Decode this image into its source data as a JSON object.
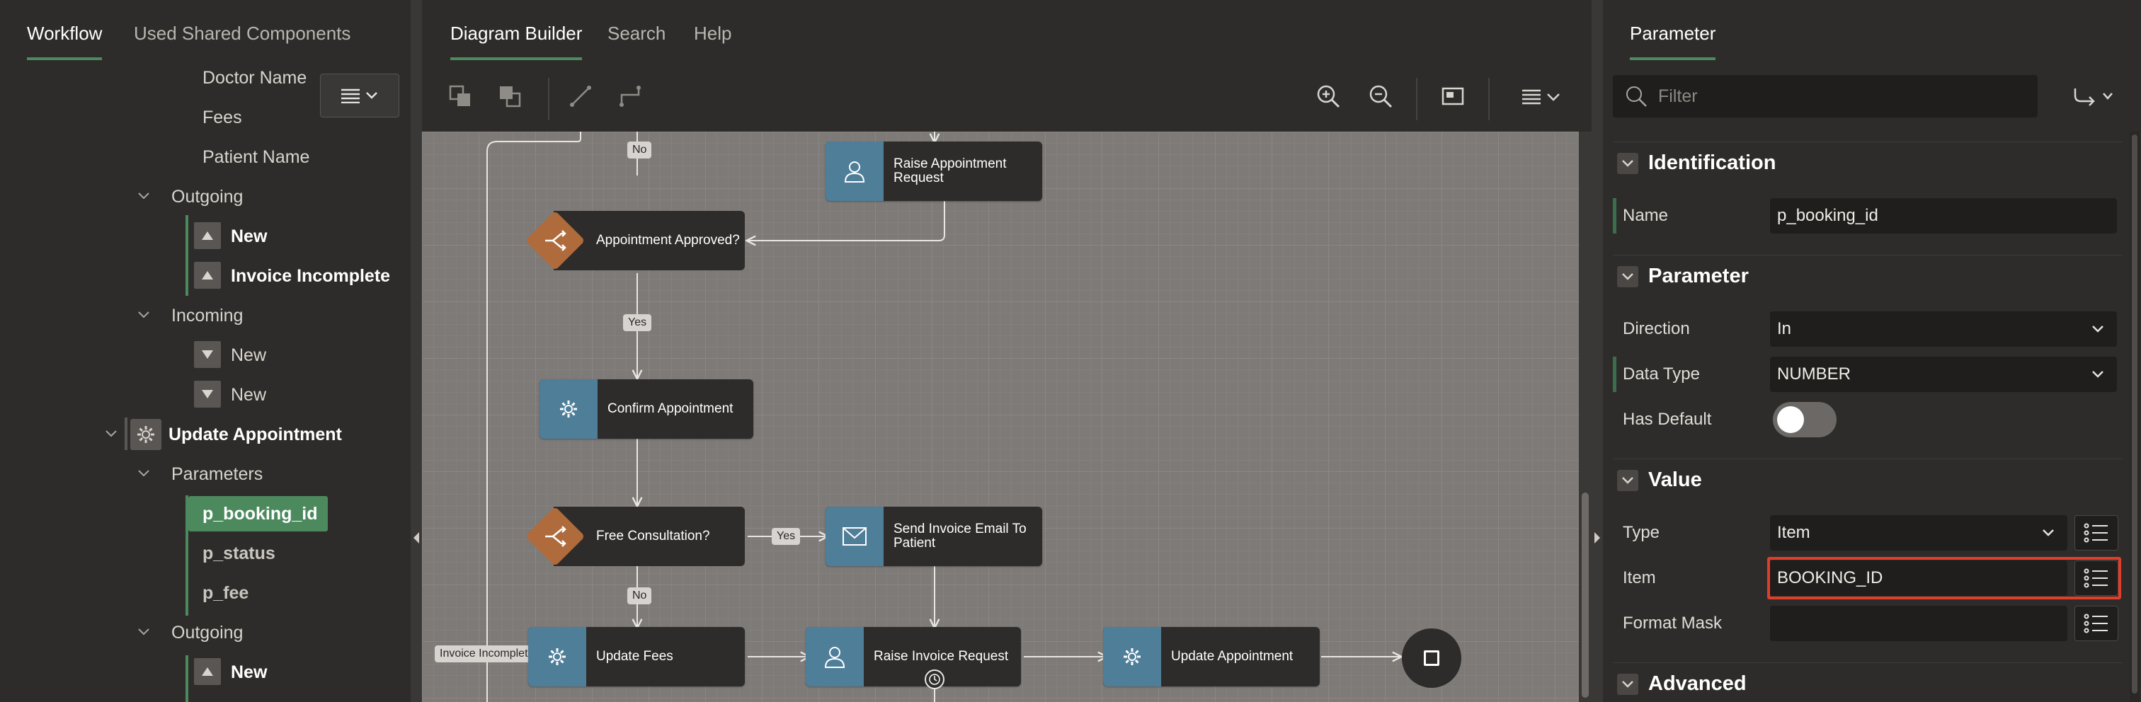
{
  "left": {
    "tabs": [
      "Workflow",
      "Used Shared Components"
    ],
    "items": {
      "doctor_name": "Doctor Name",
      "fees": "Fees",
      "patient_name": "Patient Name",
      "outgoing1": "Outgoing",
      "new1": "New",
      "invoice_incomplete": "Invoice Incomplete",
      "incoming": "Incoming",
      "new2": "New",
      "new3": "New",
      "update_appointment": "Update Appointment",
      "parameters": "Parameters",
      "p_booking_id": "p_booking_id",
      "p_status": "p_status",
      "p_fee": "p_fee",
      "outgoing2": "Outgoing",
      "new4": "New"
    }
  },
  "center": {
    "tabs": [
      "Diagram Builder",
      "Search",
      "Help"
    ],
    "nodes": {
      "raise_appointment": "Raise Appointment Request",
      "appointment_approved": "Appointment Approved?",
      "confirm_appointment": "Confirm Appointment",
      "free_consultation": "Free Consultation?",
      "send_invoice": "Send Invoice Email To Patient",
      "update_fees": "Update Fees",
      "raise_invoice": "Raise Invoice Request",
      "update_appointment": "Update Appointment"
    },
    "labels": {
      "no1": "No",
      "yes1": "Yes",
      "yes2": "Yes",
      "no2": "No",
      "invoice_incomplete": "Invoice Incomplete"
    }
  },
  "right": {
    "tab": "Parameter",
    "filter_placeholder": "Filter",
    "sections": {
      "identification": "Identification",
      "parameter": "Parameter",
      "value": "Value",
      "advanced": "Advanced"
    },
    "props": {
      "name_label": "Name",
      "name_value": "p_booking_id",
      "direction_label": "Direction",
      "direction_value": "In",
      "datatype_label": "Data Type",
      "datatype_value": "NUMBER",
      "hasdefault_label": "Has Default",
      "has_default": false,
      "type_label": "Type",
      "type_value": "Item",
      "item_label": "Item",
      "item_value": "BOOKING_ID",
      "formatmask_label": "Format Mask",
      "formatmask_value": ""
    }
  },
  "colors": {
    "accent_green": "#4c8a5e",
    "task_blue": "#4f7e99",
    "gateway_orange": "#b06b3c",
    "highlight_red": "#e03d2a"
  }
}
